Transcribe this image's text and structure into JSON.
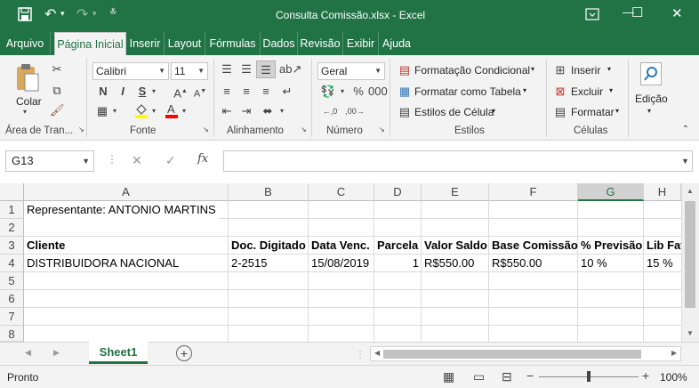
{
  "title_bar": {
    "title": "Consulta Comissão.xlsx  -  Excel",
    "save_icon": "save-icon",
    "undo_icon": "undo-icon",
    "redo_icon": "redo-icon",
    "customize_icon": "customize-quick-access-icon",
    "ribbon_options_icon": "ribbon-display-options-icon",
    "minimize_glyph": "—",
    "maximize_glyph": "☐",
    "close_glyph": "✕"
  },
  "menu_tabs": [
    "Arquivo",
    "Página Inicial",
    "Inserir",
    "Layout",
    "Fórmulas",
    "Dados",
    "Revisão",
    "Exibir",
    "Ajuda"
  ],
  "active_tab": "Página Inicial",
  "ribbon": {
    "clipboard": {
      "paste_label": "Colar",
      "group_label": "Área de Tran..."
    },
    "font": {
      "font_name": "Calibri",
      "font_size": "11",
      "bold": "N",
      "italic": "I",
      "underline": "S",
      "group_label": "Fonte"
    },
    "alignment": {
      "group_label": "Alinhamento"
    },
    "number": {
      "format": "Geral",
      "group_label": "Número"
    },
    "styles": {
      "conditional": "Formatação Condicional",
      "table": "Formatar como Tabela",
      "cell_styles": "Estilos de Célula",
      "group_label": "Estilos"
    },
    "cells": {
      "insert": "Inserir",
      "delete": "Excluir",
      "format": "Formatar",
      "group_label": "Células"
    },
    "editing": {
      "label": "Edição"
    }
  },
  "formula_bar": {
    "name_box": "G13",
    "fx_label": "fx",
    "formula": ""
  },
  "columns": [
    "A",
    "B",
    "C",
    "D",
    "E",
    "F",
    "G",
    "H"
  ],
  "selected_column": "G",
  "rows": [
    "1",
    "2",
    "3",
    "4",
    "5",
    "6",
    "7",
    "8"
  ],
  "cells": {
    "a1": "Representante: ANTONIO MARTINS",
    "header": [
      "Cliente",
      "Doc. Digitado",
      "Data Venc.",
      "Parcela",
      "Valor Saldo",
      "Base Comissão",
      "% Previsão",
      "Lib Fat"
    ],
    "row4": [
      "DISTRIBUIDORA NACIONAL",
      "2-2515",
      "15/08/2019",
      "1",
      "R$550.00",
      "R$550.00",
      "10 %",
      "15 %"
    ]
  },
  "sheet_tabs": [
    "Sheet1"
  ],
  "status": {
    "ready": "Pronto",
    "zoom": "100%"
  },
  "colors": {
    "accent": "#217346"
  }
}
